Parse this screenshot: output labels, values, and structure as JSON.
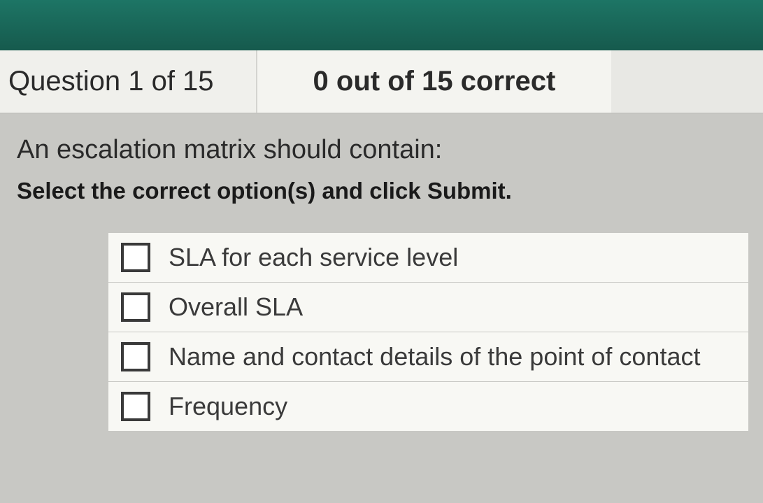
{
  "header": {
    "question_progress": "Question 1 of 15",
    "score_status": "0 out of 15 correct"
  },
  "question": {
    "prompt": "An escalation matrix should contain:",
    "instruction": "Select the correct option(s) and click Submit."
  },
  "options": [
    {
      "label": "SLA for each service level"
    },
    {
      "label": "Overall SLA"
    },
    {
      "label": "Name and contact details of the point of contact"
    },
    {
      "label": "Frequency"
    }
  ]
}
